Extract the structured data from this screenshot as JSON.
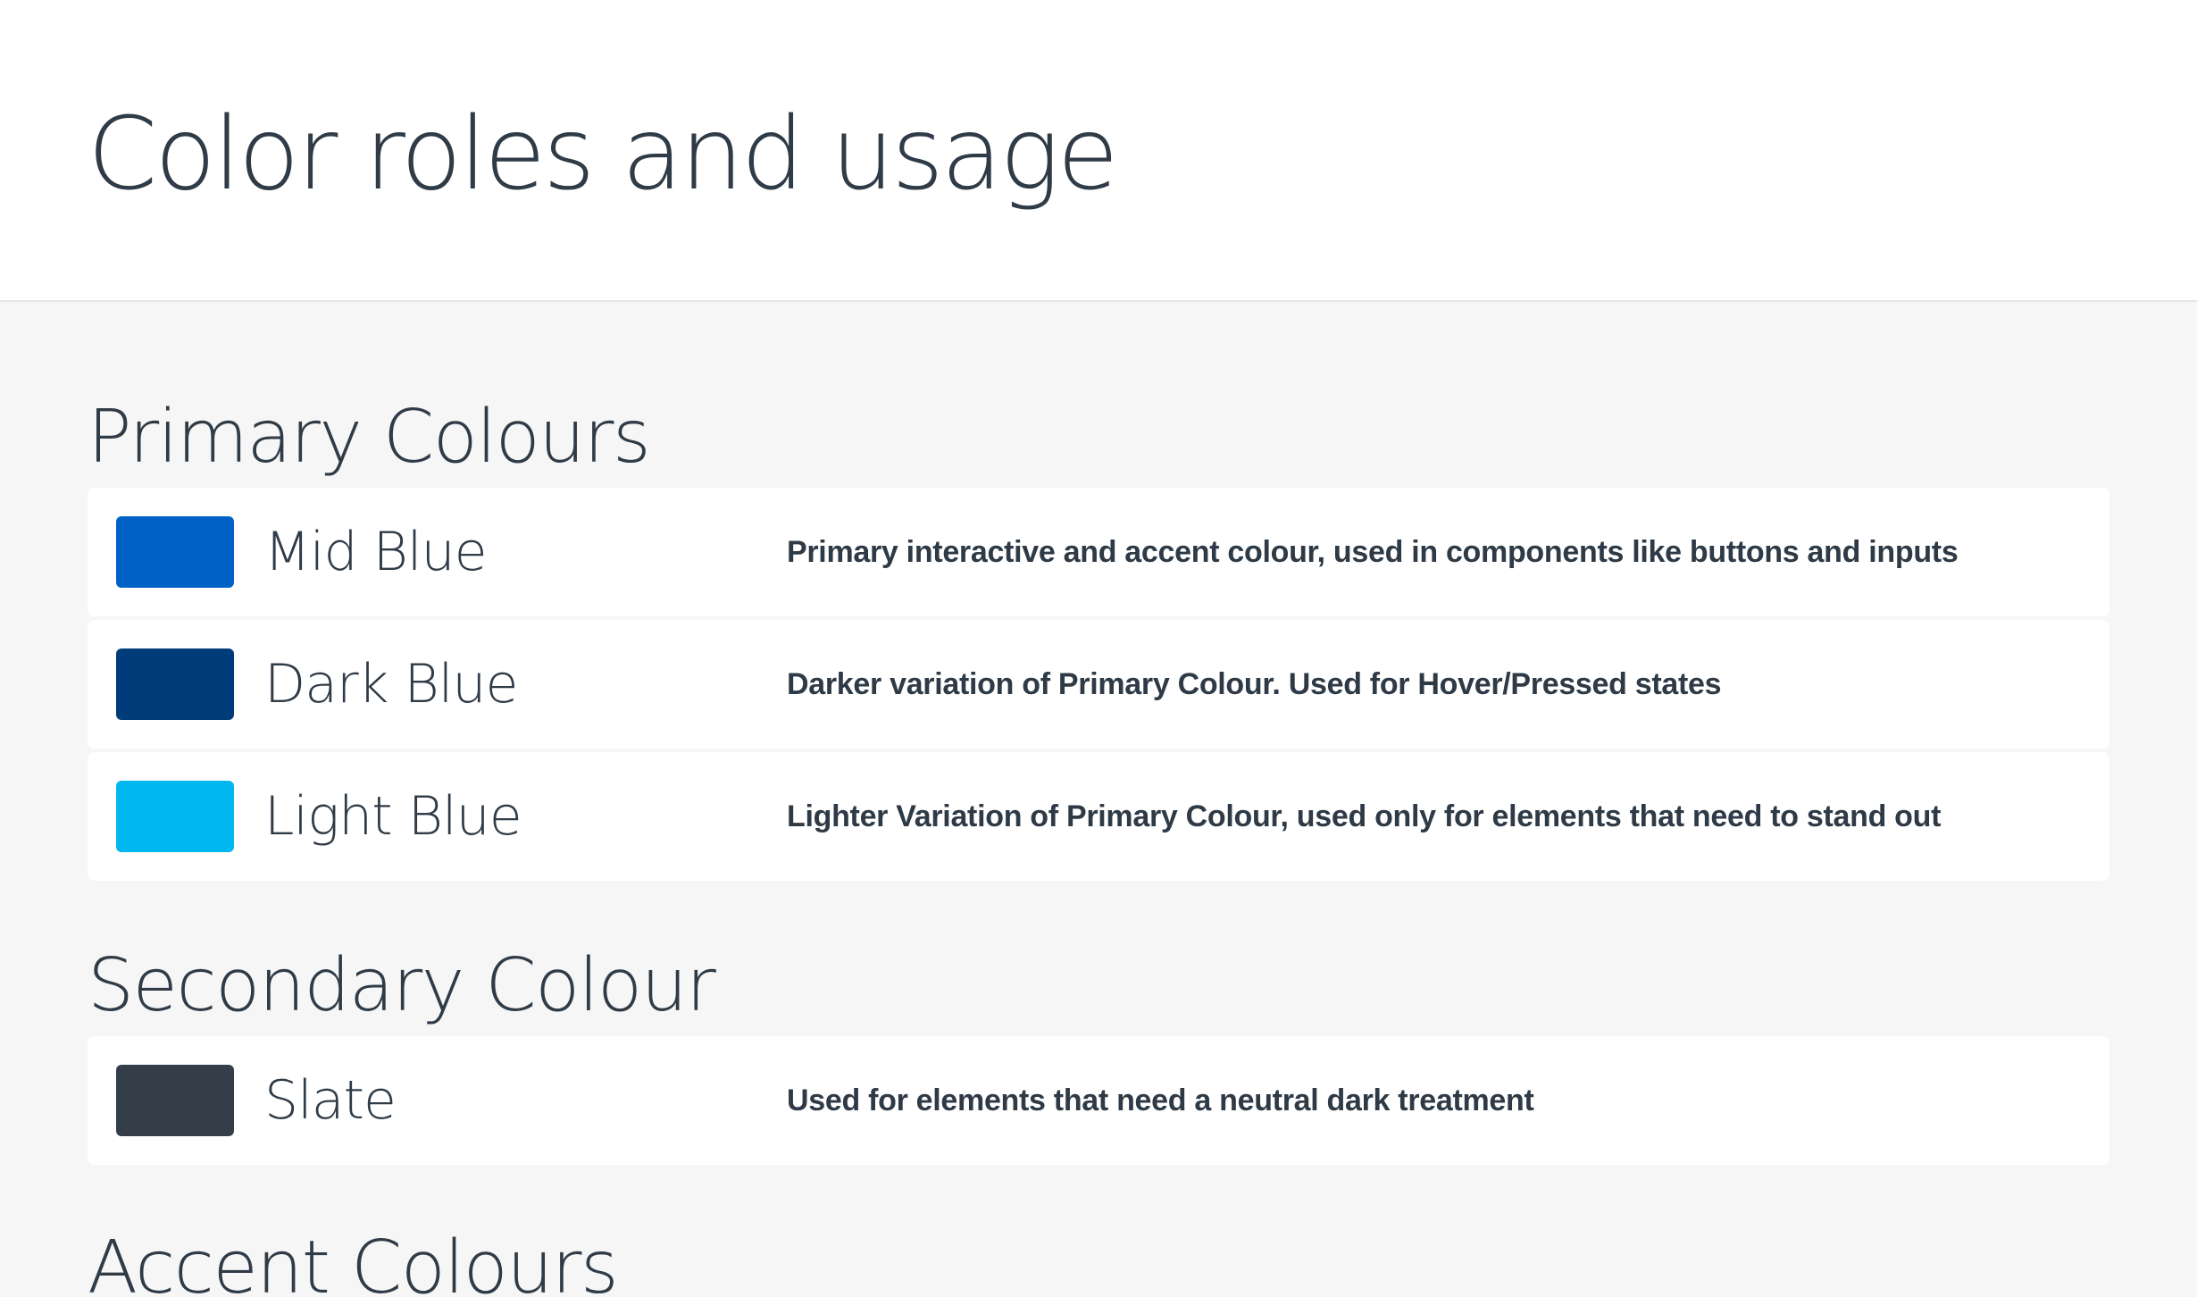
{
  "page": {
    "title": "Color roles and usage"
  },
  "sections": [
    {
      "title": "Primary Colours",
      "colors": [
        {
          "name": "Mid Blue",
          "hex": "#0062c6",
          "description": "Primary interactive and accent colour, used in components like buttons and inputs"
        },
        {
          "name": "Dark Blue",
          "hex": "#003b7a",
          "description": "Darker variation of Primary Colour. Used for Hover/Pressed states"
        },
        {
          "name": "Light Blue",
          "hex": "#00b7ef",
          "description": "Lighter Variation of Primary Colour, used only for elements that need to stand out"
        }
      ]
    },
    {
      "title": "Secondary Colour",
      "colors": [
        {
          "name": "Slate",
          "hex": "#343e49",
          "description": "Used for elements that need a neutral dark treatment"
        }
      ]
    },
    {
      "title": "Accent Colours",
      "colors": []
    }
  ],
  "theme": {
    "background": "#f6f6f6",
    "card": "#ffffff",
    "text": "#2f3b47"
  }
}
